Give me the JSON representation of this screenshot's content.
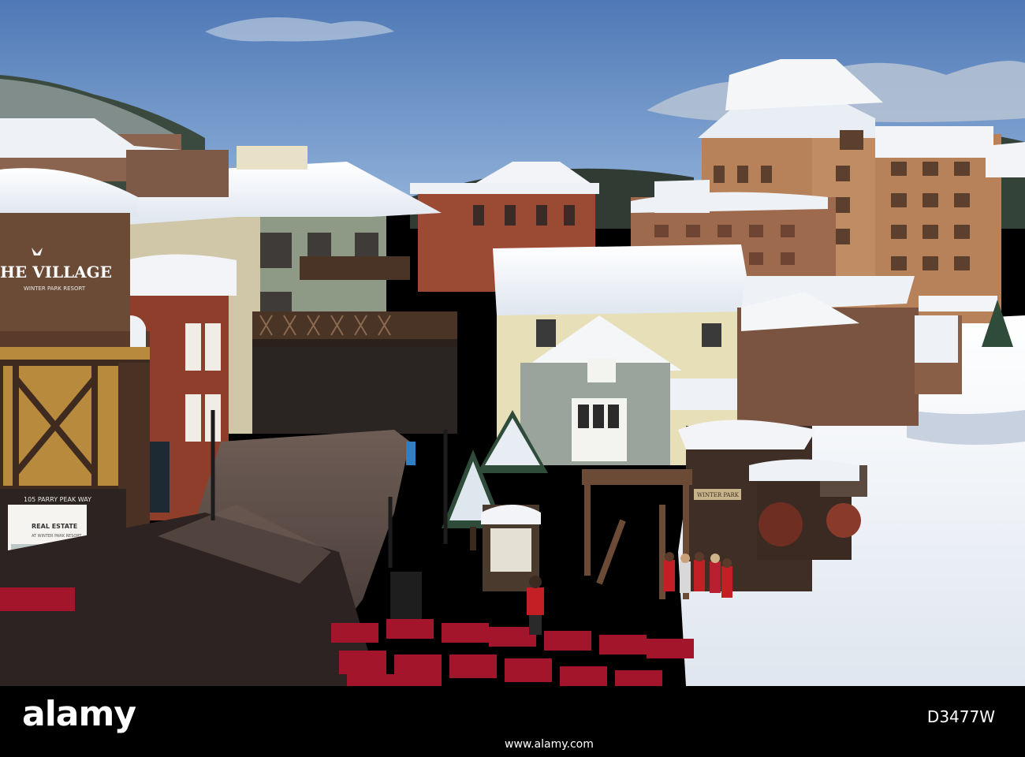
{
  "photo": {
    "signs": {
      "main_title": "HE VILLAGE",
      "main_subtitle": "WINTER PARK RESORT",
      "address": "105 PARRY PEAK WAY",
      "real_estate": "REAL ESTATE",
      "real_estate_sub": "AT WINTER PARK RESORT",
      "train_sign": "WINTER PARK"
    },
    "colors": {
      "sky": "#5f86bf",
      "snow": "#f2f4f7",
      "brick": "#9b4a34",
      "wood_dark": "#4a3426",
      "hotel": "#b8825a",
      "plaza": "#5b4b46"
    }
  },
  "watermark": {
    "brand": "alamy",
    "image_id": "D3477W",
    "site": "www.alamy.com"
  }
}
